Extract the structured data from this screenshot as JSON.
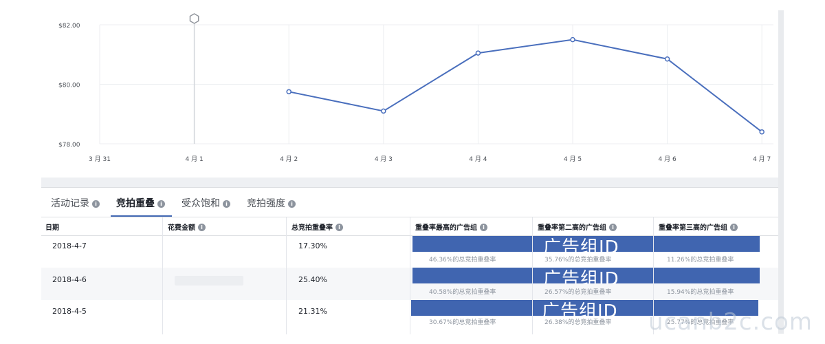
{
  "chart_data": {
    "type": "line",
    "categories": [
      "3 月 31",
      "4 月 1",
      "4 月 2",
      "4 月 3",
      "4 月 4",
      "4 月 5",
      "4 月 6",
      "4 月 7"
    ],
    "series": [
      {
        "values": [
          null,
          null,
          79.75,
          79.1,
          81.05,
          81.5,
          80.85,
          78.4
        ]
      }
    ],
    "yticks": [
      "$82.00",
      "$80.00",
      "$78.00"
    ],
    "ylim": [
      78,
      82
    ],
    "grid": true,
    "line_color": "#4a6fbd",
    "marker_label_category": "4 月 1"
  },
  "tabs": [
    {
      "label": "活动记录",
      "active": false
    },
    {
      "label": "竞拍重叠",
      "active": true
    },
    {
      "label": "受众饱和",
      "active": false
    },
    {
      "label": "竞拍强度",
      "active": false
    }
  ],
  "table": {
    "headers": [
      "日期",
      "花费金额",
      "总竞拍重叠率",
      "重叠率最高的广告组",
      "重叠率第二高的广告组",
      "重叠率第三高的广告组"
    ],
    "rows": [
      {
        "date": "2018-4-7",
        "spend": "",
        "overlap": "17.30%",
        "bar_text": "广告组ID",
        "top1": "46.36%的总竞拍重叠率",
        "top2": "35.76%的总竞拍重叠率",
        "top3": "11.26%的总竞拍重叠率"
      },
      {
        "date": "2018-4-6",
        "spend": "",
        "overlap": "25.40%",
        "bar_text": "广告组ID",
        "top1": "40.58%的总竞拍重叠率",
        "top2": "26.57%的总竞拍重叠率",
        "top3": "15.94%的总竞拍重叠率"
      },
      {
        "date": "2018-4-5",
        "spend": "",
        "overlap": "21.31%",
        "bar_text": "广告组ID",
        "top1": "30.67%的总竞拍重叠率",
        "top2": "26.38%的总竞拍重叠率",
        "top3": "25.77%的总竞拍重叠率"
      }
    ]
  },
  "watermark": "ucanb2c.com",
  "colors": {
    "accent": "#4267b2",
    "redaction_bar": "#4065b0",
    "line": "#4a6fbd"
  }
}
